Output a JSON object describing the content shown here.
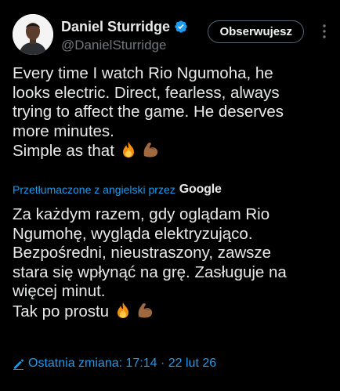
{
  "author": {
    "display_name": "Daniel Sturridge",
    "handle": "@DanielSturridge",
    "verified": true
  },
  "follow_button_label": "Obserwujesz",
  "tweet": {
    "lines": [
      "Every time I watch Rio Ngumoha, he",
      "looks electric. Direct, fearless, always",
      "trying to affect the game. He deserves",
      "more minutes.",
      "Simple as that"
    ],
    "emojis": [
      "fire",
      "flexed-biceps"
    ]
  },
  "translation": {
    "label": "Przetłumaczone z angielski przez",
    "provider": "Google",
    "lines": [
      "Za każdym razem, gdy oglądam Rio",
      "Ngumohę, wygląda elektryzująco.",
      "Bezpośredni, nieustraszony, zawsze",
      "stara się wpłynąć na grę. Zasługuje na",
      "więcej minut.",
      "Tak po prostu"
    ]
  },
  "edit_info": "Ostatnia zmiana: 17:14 · 22 lut 26",
  "colors": {
    "background": "#000000",
    "text": "#e7e9ea",
    "secondary": "#71767b",
    "accent": "#1d9bf0"
  }
}
